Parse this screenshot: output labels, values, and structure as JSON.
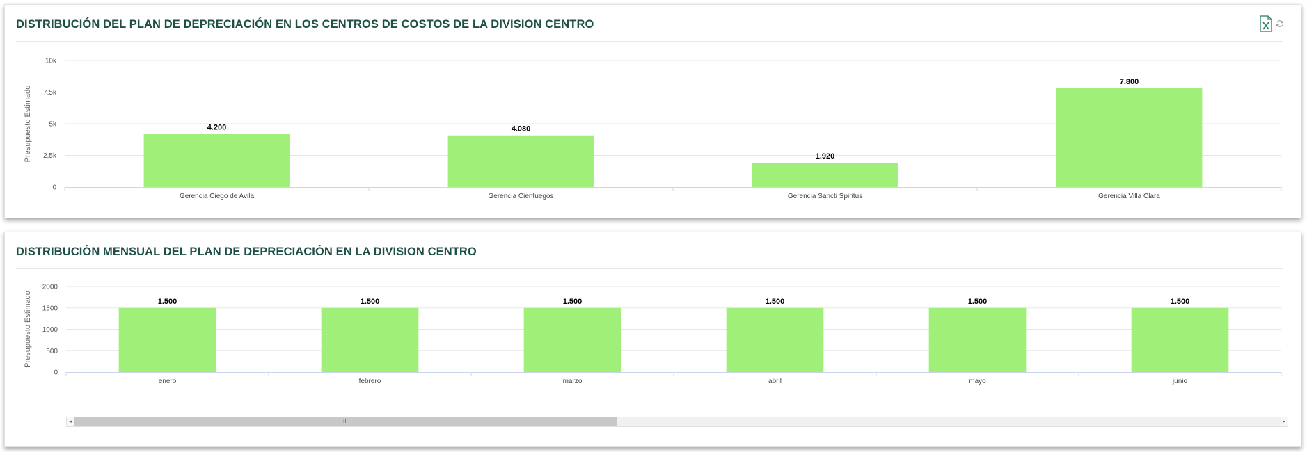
{
  "panels": [
    {
      "title": "DISTRIBUCIÓN DEL PLAN DE DEPRECIACIÓN EN LOS CENTROS DE COSTOS DE LA DIVISION CENTRO",
      "toolbar": {
        "excel_icon": "excel-icon",
        "refresh_icon": "refresh-icon"
      }
    },
    {
      "title": "DISTRIBUCIÓN MENSUAL DEL PLAN DE DEPRECIACIÓN EN LA DIVISION CENTRO",
      "scrollbar": {
        "grip": "III",
        "left_arrow": "◂",
        "right_arrow": "▸",
        "visible_fraction": 0.45
      }
    }
  ],
  "chart_data": [
    {
      "type": "bar",
      "title": "",
      "xlabel": "",
      "ylabel": "Presupuesto Estimado",
      "categories": [
        "Gerencia Ciego de Avila",
        "Gerencia Cienfuegos",
        "Gerencia Sancti Spiritus",
        "Gerencia Villa Clara"
      ],
      "values": [
        4200,
        4080,
        1920,
        7800
      ],
      "value_labels": [
        "4.200",
        "4.080",
        "1.920",
        "7.800"
      ],
      "yticks": [
        0,
        2500,
        5000,
        7500,
        10000
      ],
      "ytick_labels": [
        "0",
        "2.5k",
        "5k",
        "7.5k",
        "10k"
      ],
      "ylim": [
        0,
        10000
      ],
      "grid": true,
      "colors": {
        "bar": "#a0ef78",
        "grid": "#e6e6e6",
        "axis": "#ccd6eb",
        "text": "#333333"
      }
    },
    {
      "type": "bar",
      "title": "",
      "xlabel": "",
      "ylabel": "Presupuesto Estimado",
      "categories": [
        "enero",
        "febrero",
        "marzo",
        "abril",
        "mayo",
        "junio"
      ],
      "values": [
        1500,
        1500,
        1500,
        1500,
        1500,
        1500
      ],
      "value_labels": [
        "1.500",
        "1.500",
        "1.500",
        "1.500",
        "1.500",
        "1.500"
      ],
      "yticks": [
        0,
        500,
        1000,
        1500,
        2000
      ],
      "ytick_labels": [
        "0",
        "500",
        "1000",
        "1500",
        "2000"
      ],
      "ylim": [
        0,
        2000
      ],
      "grid": true,
      "colors": {
        "bar": "#a0ef78",
        "grid": "#e6e6e6",
        "axis": "#ccd6eb",
        "text": "#333333"
      }
    }
  ]
}
